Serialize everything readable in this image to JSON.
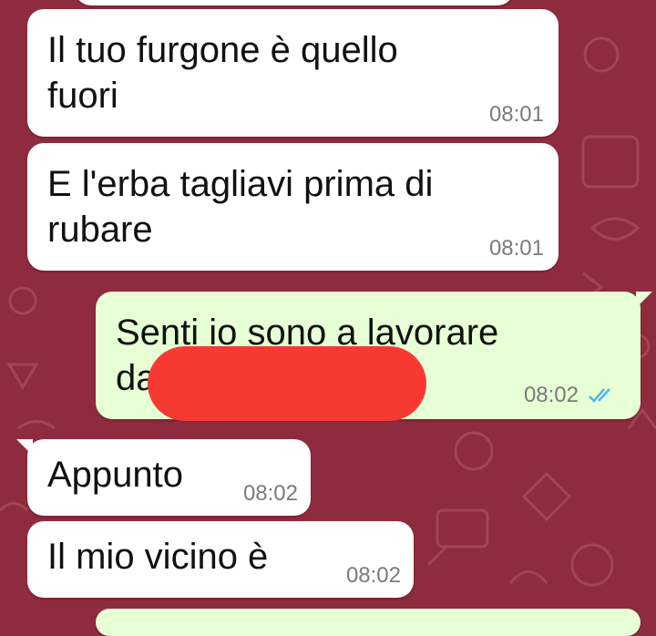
{
  "colors": {
    "wallpaper": "#8f2b3e",
    "incoming_bubble": "#ffffff",
    "outgoing_bubble": "#e6ffd4",
    "read_ticks": "#4fb6ec",
    "redaction": "#f63a33"
  },
  "messages": [
    {
      "direction": "incoming",
      "text": "Il tuo furgone è quello\nfuori",
      "time": "08:01"
    },
    {
      "direction": "incoming",
      "text": "E l'erba tagliavi prima di\nrubare",
      "time": "08:01"
    },
    {
      "direction": "outgoing",
      "text": "Senti io sono a lavorare\nda",
      "time": "08:02",
      "status_icon": "double-check-read-icon"
    },
    {
      "direction": "incoming",
      "text": "Appunto",
      "time": "08:02"
    },
    {
      "direction": "incoming",
      "text": "Il mio vicino è",
      "time": "08:02"
    }
  ]
}
